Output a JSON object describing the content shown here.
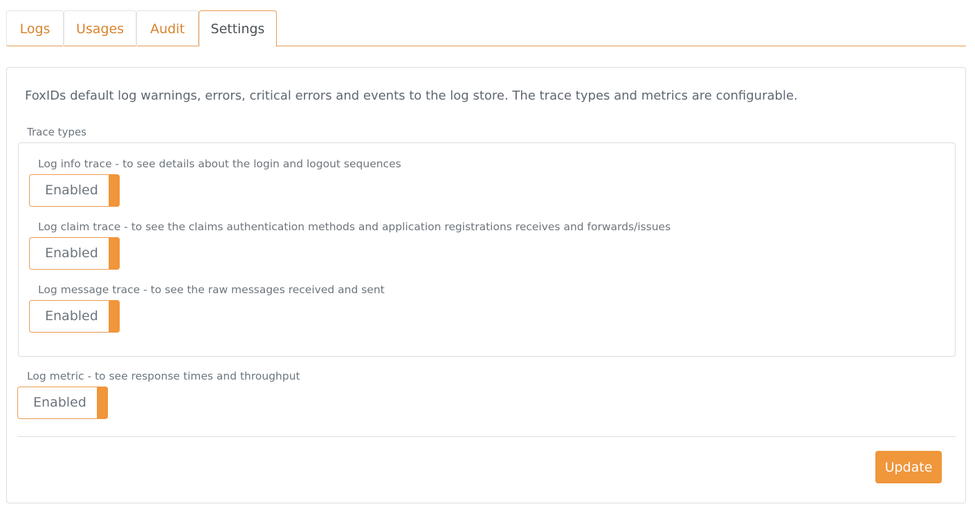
{
  "tabs": [
    {
      "label": "Logs",
      "active": false
    },
    {
      "label": "Usages",
      "active": false
    },
    {
      "label": "Audit",
      "active": false
    },
    {
      "label": "Settings",
      "active": true
    }
  ],
  "settings": {
    "intro": "FoxIDs default log warnings, errors, critical errors and events to the log store. The trace types and metrics are configurable.",
    "trace_types_label": "Trace types",
    "trace_types": [
      {
        "label": "Log info trace - to see details about the login and logout sequences",
        "state": "Enabled"
      },
      {
        "label": "Log claim trace - to see the claims authentication methods and application registrations receives and forwards/issues",
        "state": "Enabled"
      },
      {
        "label": "Log message trace - to see the raw messages received and sent",
        "state": "Enabled"
      }
    ],
    "metric": {
      "label": "Log metric - to see response times and throughput",
      "state": "Enabled"
    },
    "update_label": "Update"
  },
  "colors": {
    "accent": "#f0963b",
    "tab_text": "#d9822b",
    "border": "#dcdcdc"
  }
}
